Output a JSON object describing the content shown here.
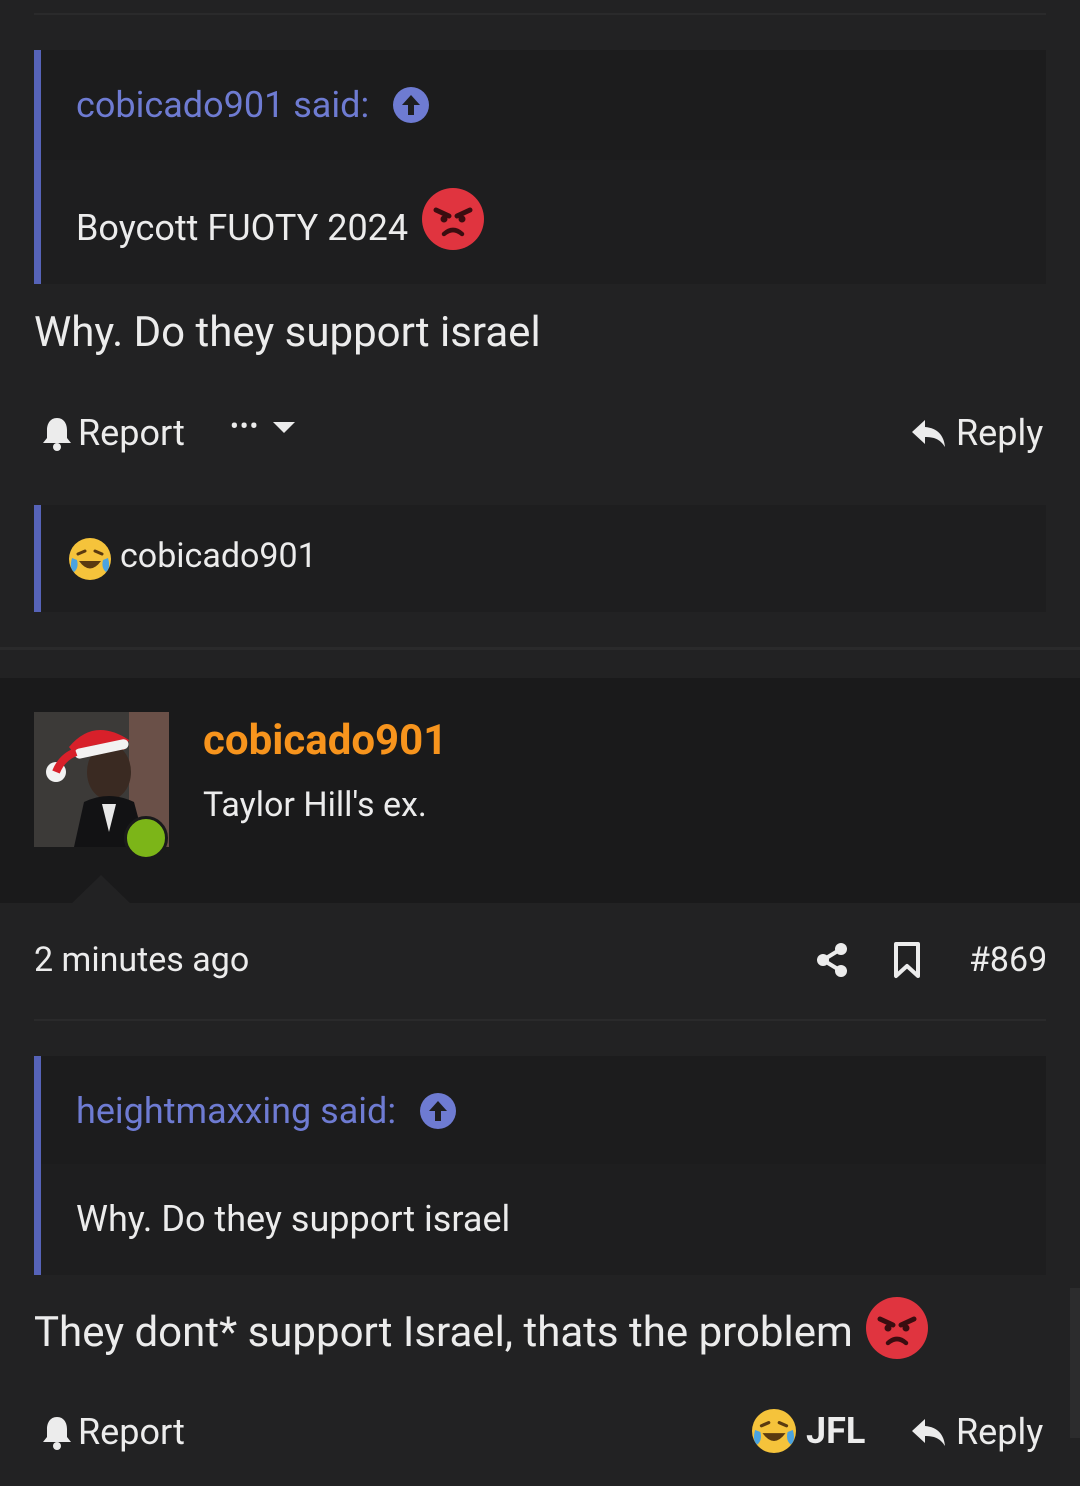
{
  "post1": {
    "quote": {
      "author_said": "cobicado901 said:",
      "text": "Boycott FUOTY 2024"
    },
    "body": "Why. Do they support israel",
    "actions": {
      "report": "Report",
      "more": "•••",
      "reply": "Reply"
    },
    "reactions": {
      "user": "cobicado901"
    }
  },
  "post2": {
    "author": {
      "name": "cobicado901",
      "title": "Taylor Hill's ex."
    },
    "meta": {
      "time": "2 minutes ago",
      "post_number": "#869"
    },
    "quote": {
      "author_said": "heightmaxxing said:",
      "text": "Why. Do they support israel"
    },
    "body": "They dont* support Israel, thats the problem",
    "actions": {
      "report": "Report",
      "react_label": "JFL",
      "reply": "Reply"
    }
  },
  "colors": {
    "background": "#222223",
    "quote_accent": "#5663b8",
    "quote_name": "#6e7bd2",
    "username": "#f7941d",
    "online": "#7cb518",
    "angry_emoji": "#e0343f"
  }
}
